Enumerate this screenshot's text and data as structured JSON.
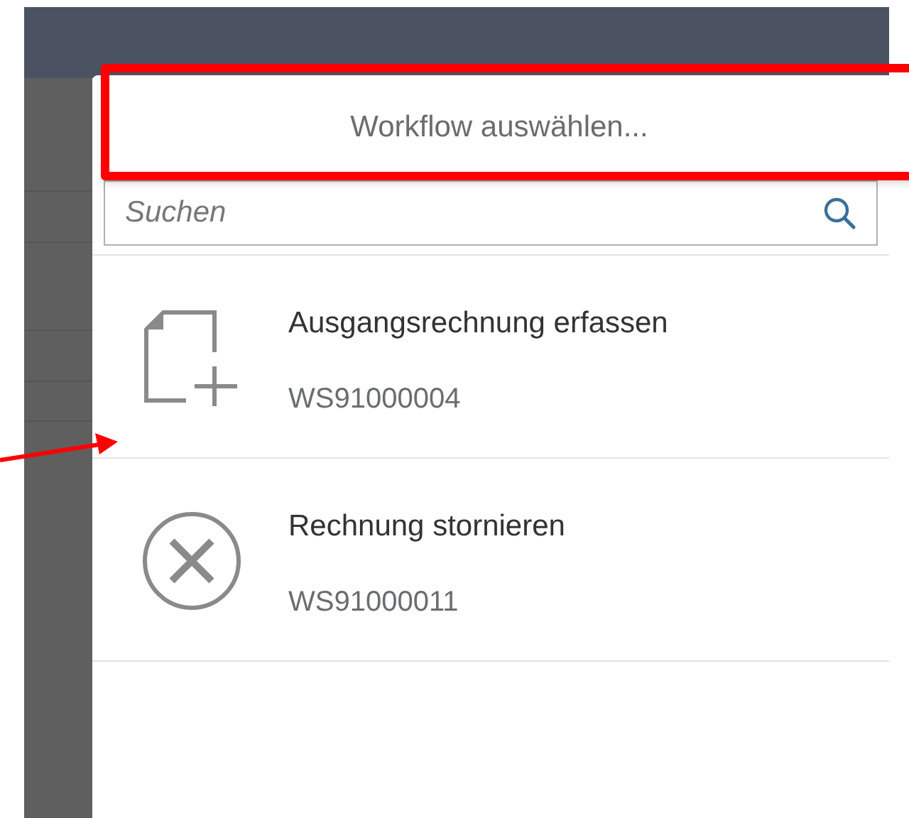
{
  "dialog": {
    "title": "Workflow auswählen...",
    "search": {
      "placeholder": "Suchen"
    },
    "items": [
      {
        "kind": "create",
        "title": "Ausgangsrechnung erfassen",
        "id": "WS91000004"
      },
      {
        "kind": "cancel",
        "title": "Rechnung stornieren",
        "id": "WS91000011"
      }
    ]
  }
}
